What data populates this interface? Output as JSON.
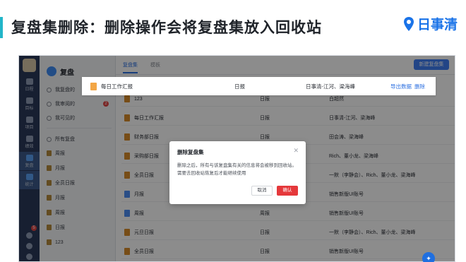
{
  "slide": {
    "title": "复盘集删除：删除操作会将复盘集放入回收站",
    "brand": "日事清"
  },
  "rail": {
    "items": [
      "日程",
      "目标",
      "项目",
      "绩效",
      "复盘",
      "统计"
    ],
    "badge": "5"
  },
  "sidebar": {
    "title": "复盘",
    "top_items": [
      {
        "label": "我复盘的"
      },
      {
        "label": "我审阅的",
        "count": "2"
      },
      {
        "label": "我可见的"
      }
    ],
    "group_label": "所有复盘",
    "items": [
      "周报",
      "月报",
      "全员日报",
      "月报",
      "周报",
      "日报",
      "123"
    ]
  },
  "main": {
    "tabs": [
      "复盘集",
      "模板"
    ],
    "new_button": "新建复盘集",
    "rows": [
      {
        "name": "123",
        "type": "日报",
        "people": "白超然",
        "icon": "folder"
      },
      {
        "name": "每日工作汇报",
        "type": "日报",
        "people": "日事清-江河、梁海峰",
        "icon": "folder"
      },
      {
        "name": "财务部日报",
        "type": "日报",
        "people": "田会涛、梁海峰",
        "icon": "folder"
      },
      {
        "name": "采购部日报",
        "type": "日报",
        "people": "Rich、董小龙、梁海峰",
        "icon": "folder"
      },
      {
        "name": "全员日报",
        "type": "日报",
        "people": "一默（李静会）、Rich、董小龙、梁海峰",
        "icon": "folder"
      },
      {
        "name": "月报",
        "type": "",
        "people": "销售新版UI账号",
        "icon": "file-blue"
      },
      {
        "name": "周报",
        "type": "周报",
        "people": "销售新版UI账号",
        "icon": "file-blue"
      },
      {
        "name": "元旦日报",
        "type": "日报",
        "people": "一默（李静会）、Rich、董小龙、梁海峰",
        "icon": "folder"
      },
      {
        "name": "全员日报",
        "type": "日报",
        "people": "销售新版UI账号",
        "icon": "folder"
      }
    ]
  },
  "highlight_row": {
    "name": "每日工作汇报",
    "type": "日报",
    "people": "日事清-江河、梁海峰",
    "export": "导出数据",
    "delete": "删除"
  },
  "dialog": {
    "title": "删除复盘集",
    "body": "删除之后，所有与该复盘集有关的信息将会被移到回收站。需要去回收站恢复后才能继续使用",
    "cancel": "取消",
    "confirm": "确认"
  }
}
